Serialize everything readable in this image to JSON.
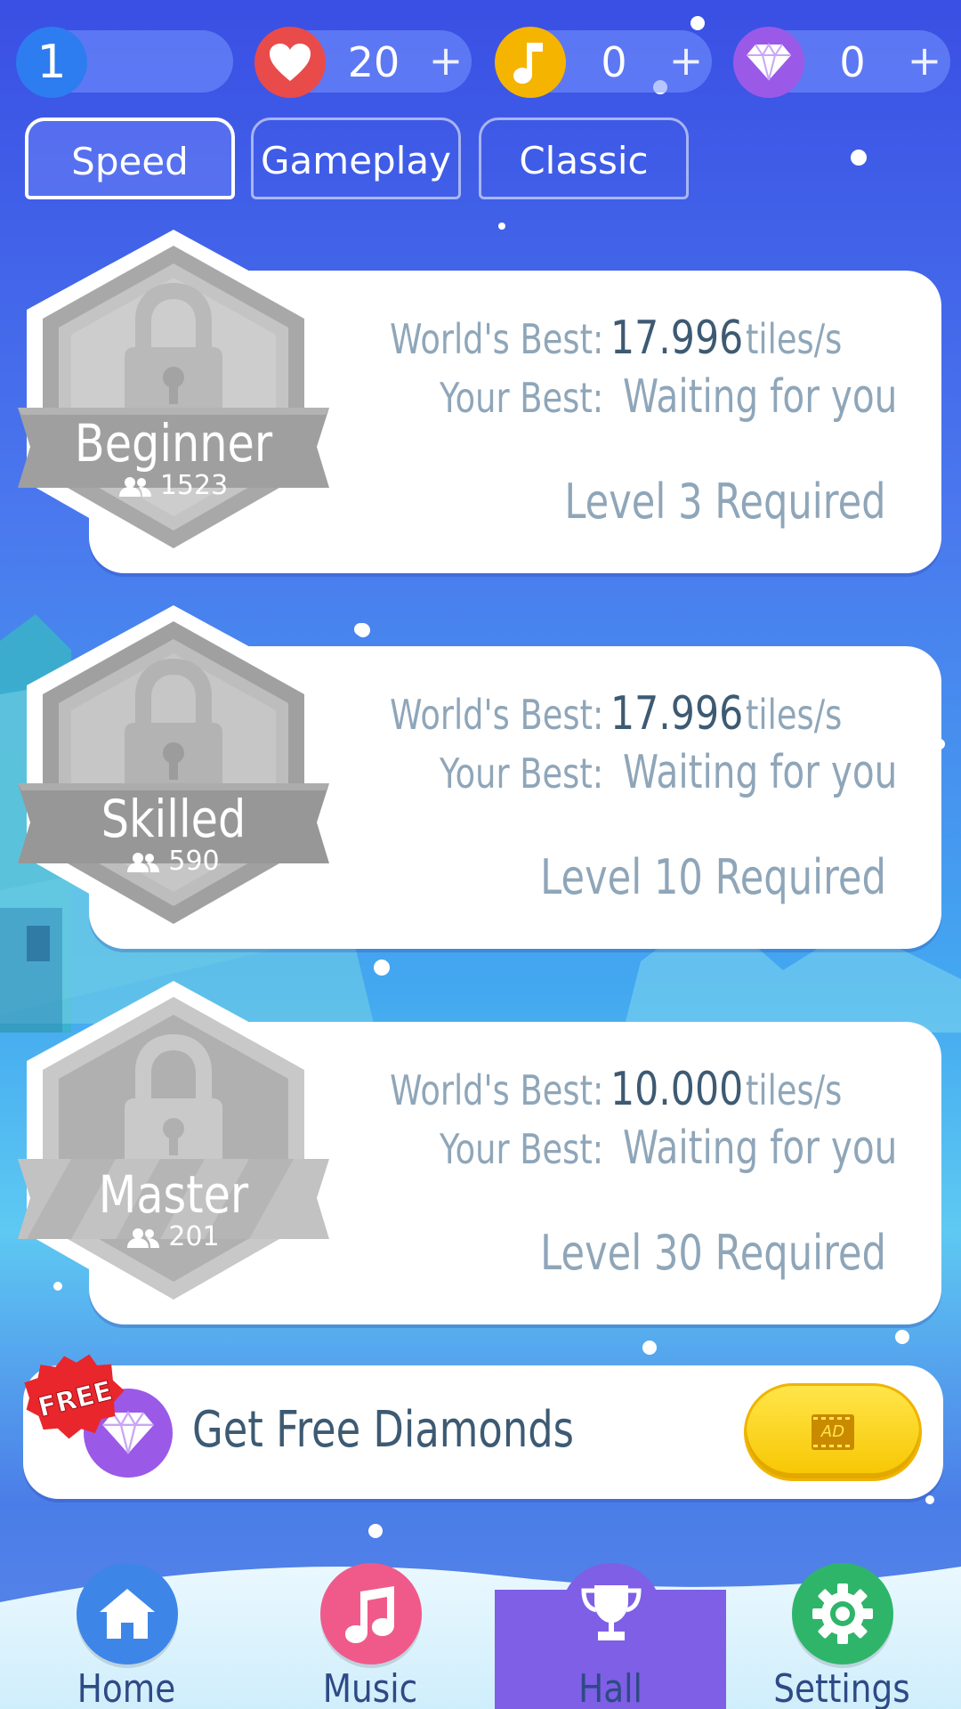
{
  "status_bar": {
    "level": "1",
    "lives": {
      "value": "20",
      "plus": "+",
      "icon": "heart-icon",
      "color": "#e94b4b"
    },
    "notes": {
      "value": "0",
      "plus": "+",
      "icon": "music-note-icon",
      "color": "#f5b400"
    },
    "diamonds": {
      "value": "0",
      "plus": "+",
      "icon": "diamond-icon",
      "color": "#9b59e8"
    },
    "level_color": "#2d7cf0"
  },
  "tabs": [
    {
      "label": "Speed",
      "active": true
    },
    {
      "label": "Gameplay",
      "active": false
    },
    {
      "label": "Classic",
      "active": false
    }
  ],
  "levels": [
    {
      "name": "Beginner",
      "players": "1523",
      "worlds_best_label": "World's Best:",
      "worlds_best_value": "17.996",
      "unit": "tiles/s",
      "your_best_label": "Your Best:",
      "your_best_value": "Waiting for you",
      "requirement": "Level 3 Required",
      "locked": true
    },
    {
      "name": "Skilled",
      "players": "590",
      "worlds_best_label": "World's Best:",
      "worlds_best_value": "17.996",
      "unit": "tiles/s",
      "your_best_label": "Your Best:",
      "your_best_value": "Waiting for you",
      "requirement": "Level 10 Required",
      "locked": true
    },
    {
      "name": "Master",
      "players": "201",
      "worlds_best_label": "World's Best:",
      "worlds_best_value": "10.000",
      "unit": "tiles/s",
      "your_best_label": "Your Best:",
      "your_best_value": "Waiting for you",
      "requirement": "Level 30 Required",
      "locked": true
    }
  ],
  "promo": {
    "tag": "FREE",
    "text": "Get Free Diamonds",
    "button_label": "AD",
    "button_color": "#f7c600"
  },
  "nav": [
    {
      "label": "Home",
      "icon": "home-icon",
      "color": "#3d86e8",
      "active": false
    },
    {
      "label": "Music",
      "icon": "music-note-icon",
      "color": "#f05a8a",
      "active": false
    },
    {
      "label": "Hall",
      "icon": "trophy-icon",
      "color": "#7e5fe6",
      "active": true
    },
    {
      "label": "Settings",
      "icon": "gear-icon",
      "color": "#2fb56a",
      "active": false
    }
  ]
}
